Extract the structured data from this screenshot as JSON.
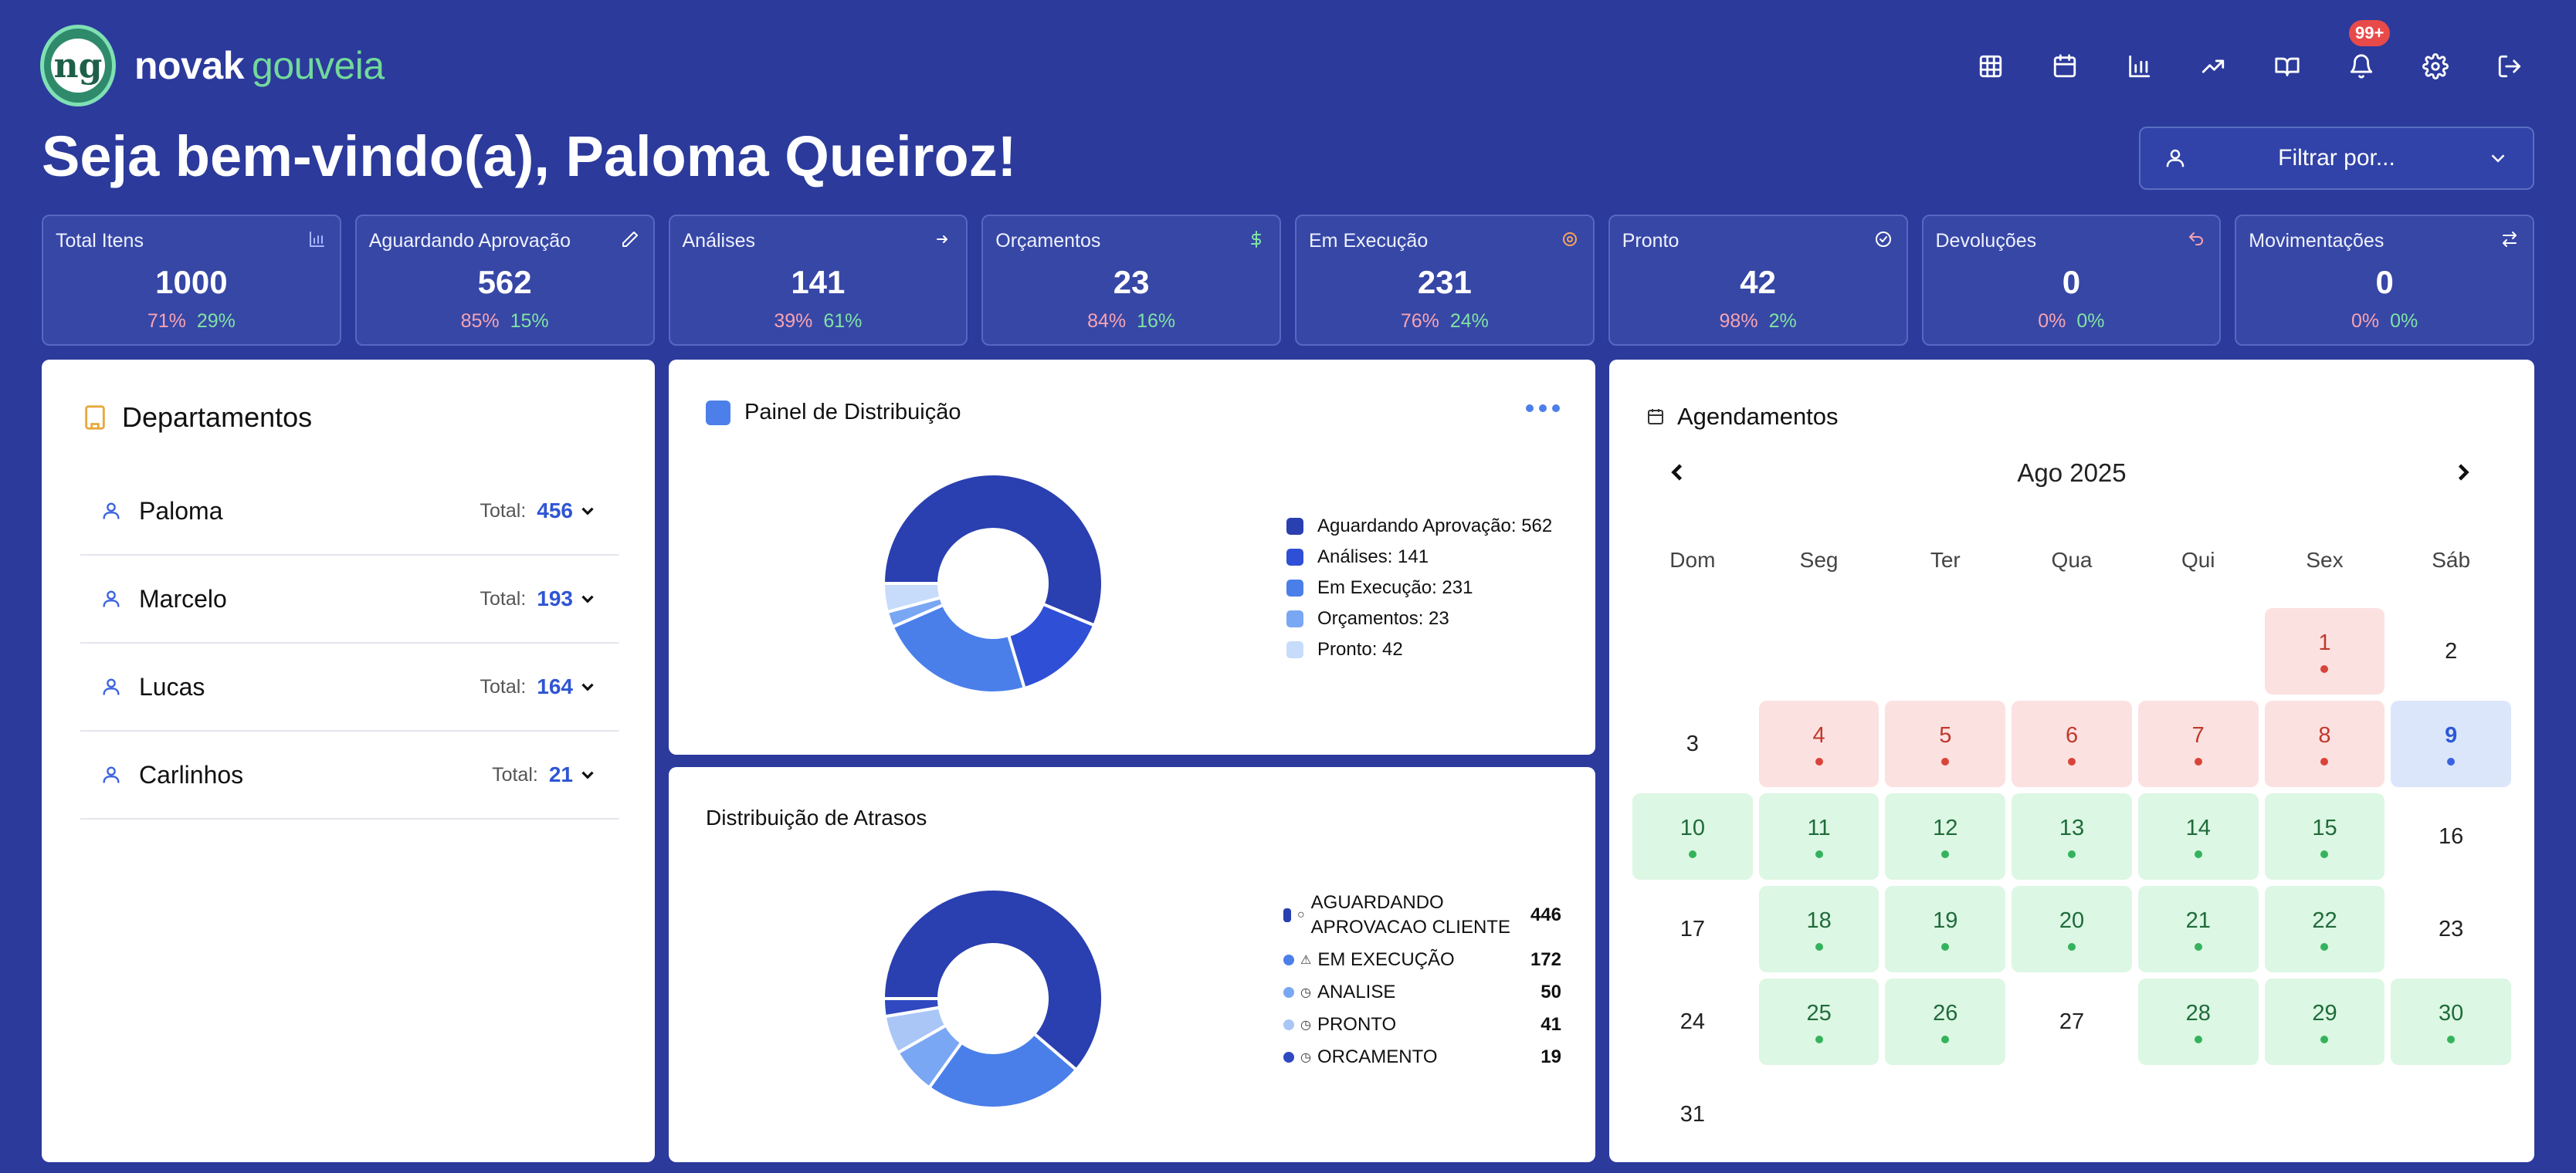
{
  "brand": {
    "logo_text": "ng",
    "name_a": "novak",
    "name_b": "gouveia"
  },
  "welcome": "Seja bem-vindo(a), Paloma Queiroz!",
  "topbar": {
    "icons": [
      "grid-icon",
      "calendar-icon",
      "bar-chart-icon",
      "trending-icon",
      "book-icon",
      "bell-icon",
      "gear-icon",
      "logout-icon"
    ],
    "notif_badge": "99+"
  },
  "filter": {
    "label": "Filtrar por..."
  },
  "stats": [
    {
      "label": "Total Itens",
      "value": "1000",
      "pa": "71%",
      "pb": "29%",
      "icon": "bar-chart-icon",
      "color": "#aab6ff"
    },
    {
      "label": "Aguardando Aprovação",
      "value": "562",
      "pa": "85%",
      "pb": "15%",
      "icon": "pencil-icon",
      "color": "#ffffff"
    },
    {
      "label": "Análises",
      "value": "141",
      "pa": "39%",
      "pb": "61%",
      "icon": "arrow-icon",
      "color": "#ffffff"
    },
    {
      "label": "Orçamentos",
      "value": "23",
      "pa": "84%",
      "pb": "16%",
      "icon": "dollar-icon",
      "color": "#7fe3a4"
    },
    {
      "label": "Em Execução",
      "value": "231",
      "pa": "76%",
      "pb": "24%",
      "icon": "cog-icon",
      "color": "#f5a35b"
    },
    {
      "label": "Pronto",
      "value": "42",
      "pa": "98%",
      "pb": "2%",
      "icon": "check-circle-icon",
      "color": "#ffffff"
    },
    {
      "label": "Devoluções",
      "value": "0",
      "pa": "0%",
      "pb": "0%",
      "icon": "return-icon",
      "color": "#f7a3b1"
    },
    {
      "label": "Movimentações",
      "value": "0",
      "pa": "0%",
      "pb": "0%",
      "icon": "swap-icon",
      "color": "#ffffff"
    }
  ],
  "departments": {
    "title": "Departamentos",
    "total_label": "Total:",
    "items": [
      {
        "name": "Paloma",
        "total": "456"
      },
      {
        "name": "Marcelo",
        "total": "193"
      },
      {
        "name": "Lucas",
        "total": "164"
      },
      {
        "name": "Carlinhos",
        "total": "21"
      }
    ]
  },
  "distribution": {
    "title": "Painel de Distribuição",
    "legend": [
      "Aguardando Aprovação: 562",
      "Análises: 141",
      "Em Execução: 231",
      "Orçamentos: 23",
      "Pronto: 42"
    ]
  },
  "delays": {
    "title": "Distribuição de Atrasos",
    "items": [
      {
        "name": "AGUARDANDO APROVACAO CLIENTE",
        "value": "446"
      },
      {
        "name": "EM EXECUÇÃO",
        "value": "172"
      },
      {
        "name": "ANALISE",
        "value": "50"
      },
      {
        "name": "PRONTO",
        "value": "41"
      },
      {
        "name": "ORCAMENTO",
        "value": "19"
      }
    ]
  },
  "calendar": {
    "title": "Agendamentos",
    "month": "Ago 2025",
    "weekdays": [
      "Dom",
      "Seg",
      "Ter",
      "Qua",
      "Qui",
      "Sex",
      "Sáb"
    ],
    "weeks": [
      [
        {
          "d": ""
        },
        {
          "d": ""
        },
        {
          "d": ""
        },
        {
          "d": ""
        },
        {
          "d": ""
        },
        {
          "d": "1",
          "s": "red"
        },
        {
          "d": "2",
          "s": "plain"
        }
      ],
      [
        {
          "d": "3",
          "s": "plain"
        },
        {
          "d": "4",
          "s": "red"
        },
        {
          "d": "5",
          "s": "red"
        },
        {
          "d": "6",
          "s": "red"
        },
        {
          "d": "7",
          "s": "red"
        },
        {
          "d": "8",
          "s": "red"
        },
        {
          "d": "9",
          "s": "blue"
        }
      ],
      [
        {
          "d": "10",
          "s": "green"
        },
        {
          "d": "11",
          "s": "green"
        },
        {
          "d": "12",
          "s": "green"
        },
        {
          "d": "13",
          "s": "green"
        },
        {
          "d": "14",
          "s": "green"
        },
        {
          "d": "15",
          "s": "green"
        },
        {
          "d": "16",
          "s": "plain"
        }
      ],
      [
        {
          "d": "17",
          "s": "plain"
        },
        {
          "d": "18",
          "s": "green"
        },
        {
          "d": "19",
          "s": "green"
        },
        {
          "d": "20",
          "s": "green"
        },
        {
          "d": "21",
          "s": "green"
        },
        {
          "d": "22",
          "s": "green"
        },
        {
          "d": "23",
          "s": "plain"
        }
      ],
      [
        {
          "d": "24",
          "s": "plain"
        },
        {
          "d": "25",
          "s": "green"
        },
        {
          "d": "26",
          "s": "green"
        },
        {
          "d": "27",
          "s": "plain"
        },
        {
          "d": "28",
          "s": "green"
        },
        {
          "d": "29",
          "s": "green"
        },
        {
          "d": "30",
          "s": "green"
        }
      ],
      [
        {
          "d": "31",
          "s": "plain"
        },
        {
          "d": ""
        },
        {
          "d": ""
        },
        {
          "d": ""
        },
        {
          "d": ""
        },
        {
          "d": ""
        },
        {
          "d": ""
        }
      ]
    ]
  },
  "chart_data": [
    {
      "type": "pie",
      "categories": [
        "Aguardando Aprovação",
        "Análises",
        "Em Execução",
        "Orçamentos",
        "Pronto"
      ],
      "values": [
        562,
        141,
        231,
        23,
        42
      ],
      "colors": [
        "#2a3fb0",
        "#2f4fd6",
        "#4a7fea",
        "#7aa7f3",
        "#c7dbfb"
      ]
    },
    {
      "type": "pie",
      "categories": [
        "AGUARDANDO APROVACAO CLIENTE",
        "EM EXECUÇÃO",
        "ANALISE",
        "PRONTO",
        "ORCAMENTO"
      ],
      "values": [
        446,
        172,
        50,
        41,
        19
      ],
      "colors": [
        "#2a3fb0",
        "#4a7fea",
        "#7aa7f3",
        "#a9c6f7",
        "#3049c0"
      ]
    }
  ]
}
